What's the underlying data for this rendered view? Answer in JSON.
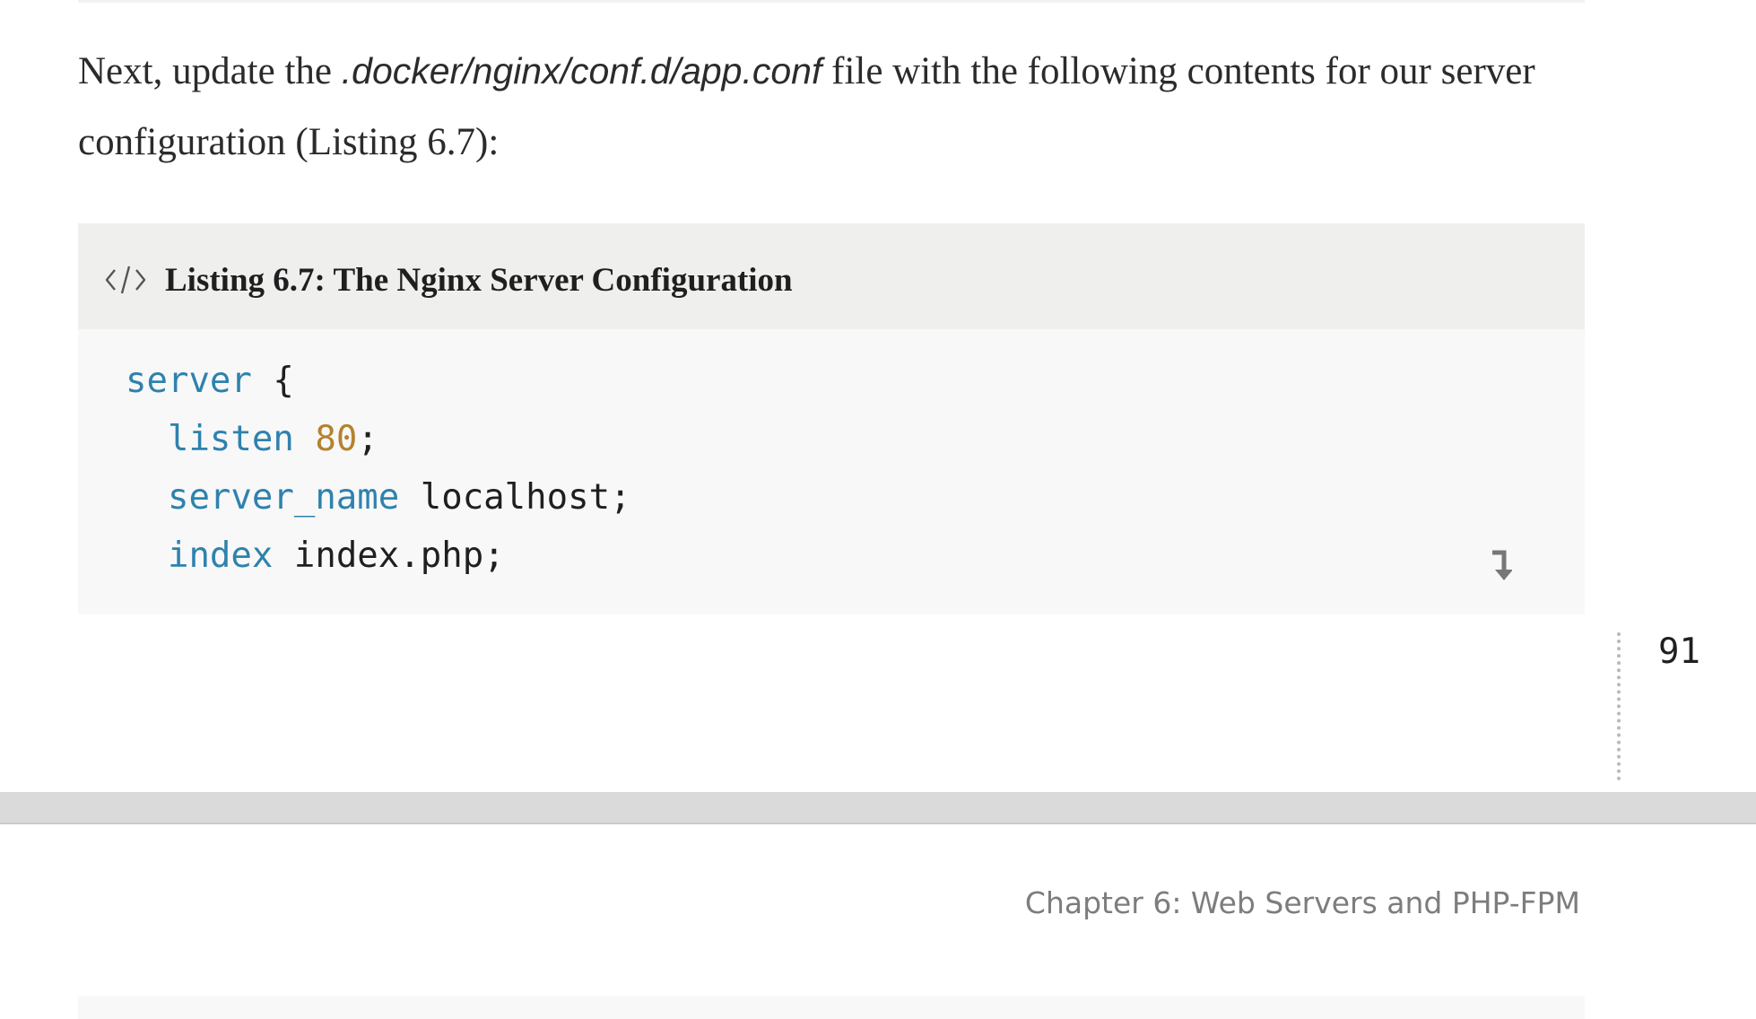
{
  "paragraph": {
    "lead": "Next, update the ",
    "path": ".docker/nginx/conf.d/app.conf",
    "tail": " file with the following contents for our server configuration (Listing 6.7):"
  },
  "listing": {
    "icon": "code-icon",
    "title": "Listing 6.7: The Nginx Server Configuration",
    "code": {
      "line1": {
        "keyword": "server",
        "rest": " {"
      },
      "line2": {
        "indent": "  ",
        "keyword": "listen",
        "space": " ",
        "number": "80",
        "rest": ";"
      },
      "line3": {
        "indent": "  ",
        "keyword": "server_name",
        "rest": " localhost;"
      },
      "line4": {
        "indent": "  ",
        "keyword": "index",
        "rest": " index.php;"
      }
    },
    "continuation_icon": "continued-arrow-icon"
  },
  "page": {
    "number": "91",
    "running_header": "Chapter 6: Web Servers and PHP-FPM"
  },
  "colors": {
    "keyword": "#2e82ad",
    "number": "#b5822f",
    "listing_header_bg": "#efefee",
    "listing_bg": "#f8f8f8"
  }
}
